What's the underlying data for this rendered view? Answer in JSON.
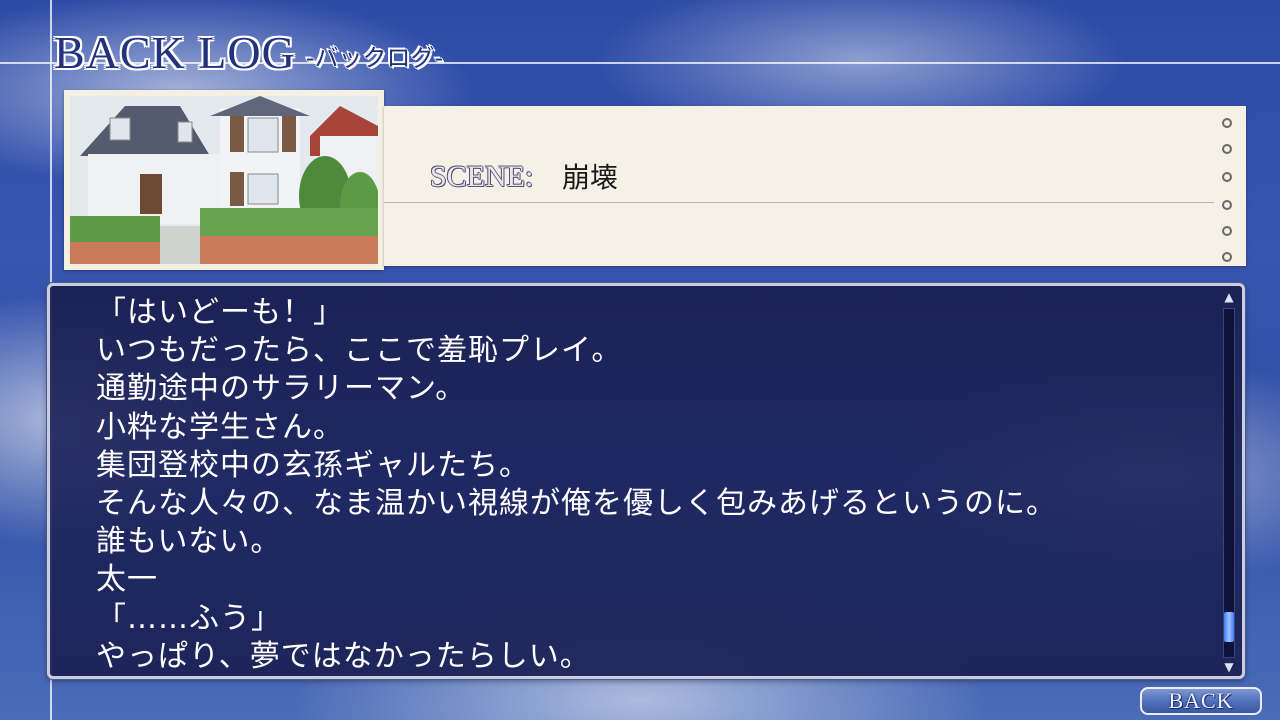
{
  "header": {
    "title": "BACK LOG",
    "subtitle": "-バックログ-"
  },
  "scene": {
    "label": "SCENE:",
    "name": "崩壊",
    "thumbnail_icon": "house-scene-thumbnail"
  },
  "log": {
    "lines": [
      "「はいどーも！」",
      "いつもだったら、ここで羞恥プレイ。",
      "通勤途中のサラリーマン。",
      "小粋な学生さん。",
      "集団登校中の玄孫ギャルたち。",
      "そんな人々の、なま温かい視線が俺を優しく包みあげるというのに。",
      "誰もいない。",
      "太一",
      "「……ふう」",
      "やっぱり、夢ではなかったらしい。"
    ],
    "scroll_position": 0.95
  },
  "scrollbar": {
    "up_icon": "scroll-up-arrow-icon",
    "down_icon": "scroll-down-arrow-icon"
  },
  "footer": {
    "back_label": "BACK"
  },
  "colors": {
    "title": "#24327e",
    "panel": "#1e245c",
    "panel_border": "#c9cede",
    "card": "#f5f1e6",
    "scroll_thumb": "#6fa0ff"
  }
}
